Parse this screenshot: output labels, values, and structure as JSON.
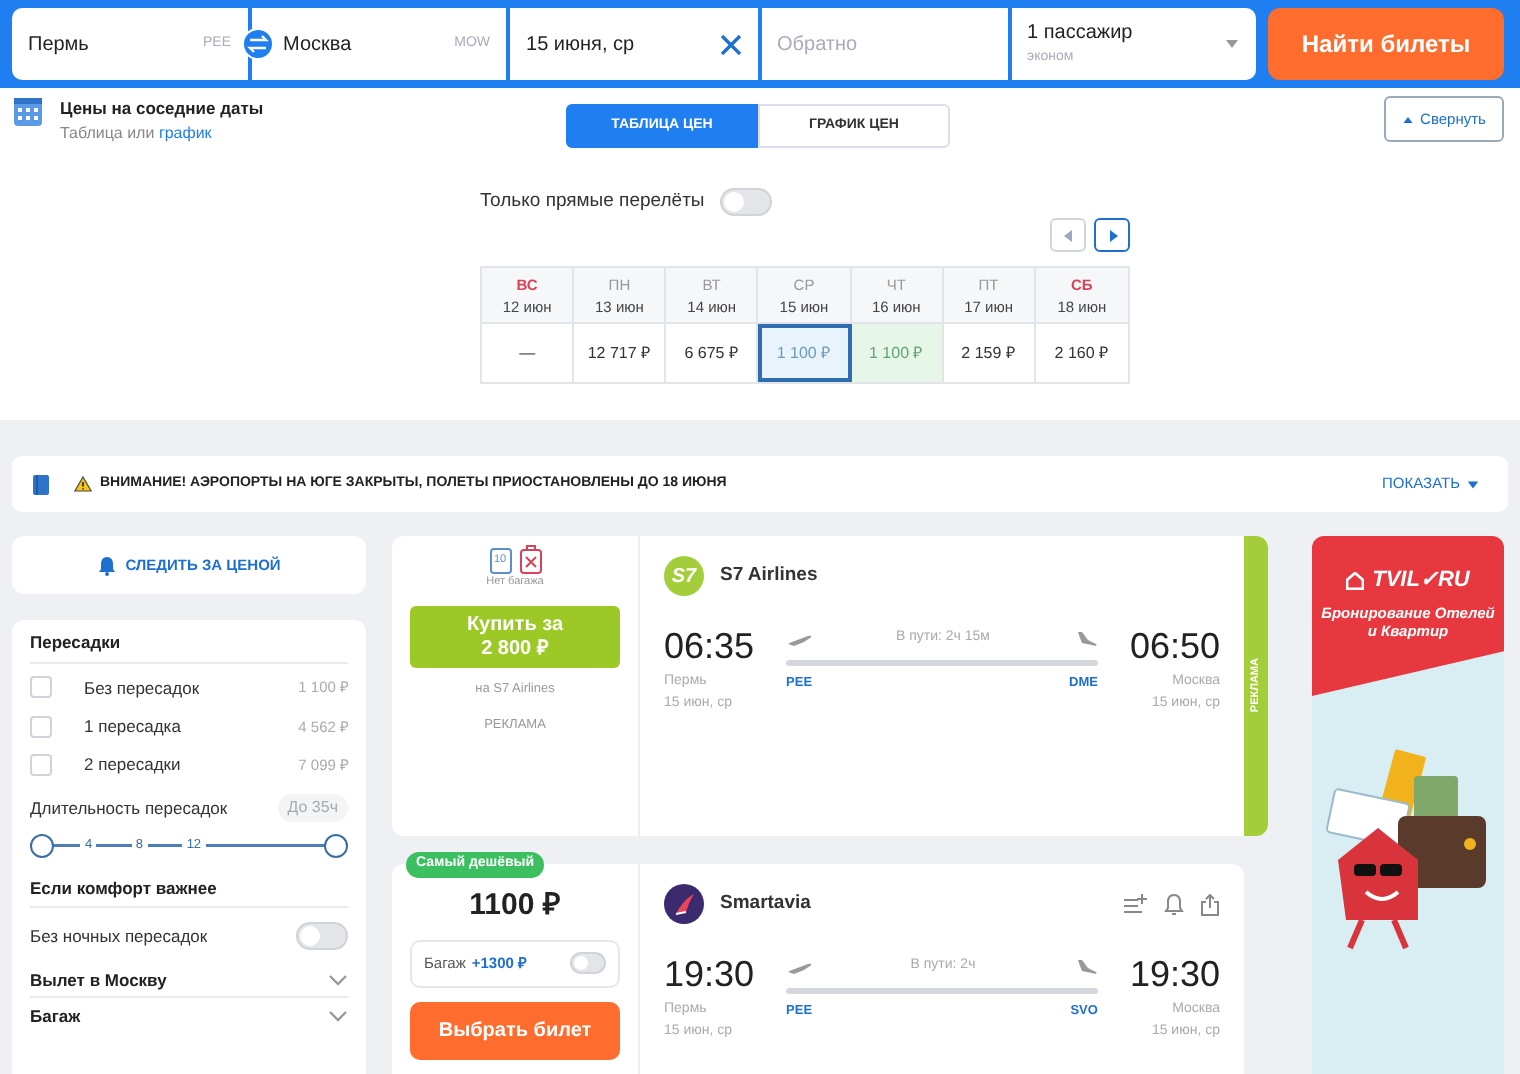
{
  "search_form": {
    "origin": {
      "city": "Пермь",
      "code": "PEE"
    },
    "destination": {
      "city": "Москва",
      "code": "MOW"
    },
    "depart_date": "15 июня, ср",
    "return_date": {
      "placeholder": "Обратно"
    },
    "passengers": {
      "count": "1 пассажир",
      "cabin": "эконом"
    },
    "search_button": "Найти билеты"
  },
  "nearby_dates": {
    "title": "Цены на соседние даты",
    "subtitle_text": "Таблица или",
    "subtitle_link": "график",
    "view_tabs": [
      {
        "label": "ТАБЛИЦА ЦЕН",
        "selected": true
      },
      {
        "label": "ГРАФИК ЦЕН",
        "selected": false
      }
    ],
    "collapse_button": "Свернуть",
    "direct_only": {
      "label": "Только прямые перелёты",
      "on": false
    },
    "days": [
      {
        "weekday": "ВС",
        "date": "12 июн",
        "price": "—",
        "weekend": true,
        "selected": false,
        "cheapest": false
      },
      {
        "weekday": "ПН",
        "date": "13 июн",
        "price": "12 717 ₽",
        "weekend": false,
        "selected": false,
        "cheapest": false
      },
      {
        "weekday": "ВТ",
        "date": "14 июн",
        "price": "6 675 ₽",
        "weekend": false,
        "selected": false,
        "cheapest": false
      },
      {
        "weekday": "СР",
        "date": "15 июн",
        "price": "1 100 ₽",
        "weekend": false,
        "selected": true,
        "cheapest": false
      },
      {
        "weekday": "ЧТ",
        "date": "16 июн",
        "price": "1 100 ₽",
        "weekend": false,
        "selected": false,
        "cheapest": true
      },
      {
        "weekday": "ПТ",
        "date": "17 июн",
        "price": "2 159 ₽",
        "weekend": false,
        "selected": false,
        "cheapest": false
      },
      {
        "weekday": "СБ",
        "date": "18 июн",
        "price": "2 160 ₽",
        "weekend": true,
        "selected": false,
        "cheapest": false
      }
    ]
  },
  "alert": {
    "text": "ВНИМАНИЕ! АЭРОПОРТЫ НА ЮГЕ ЗАКРЫТЫ, ПОЛЕТЫ ПРИОСТАНОВЛЕНЫ ДО 18 ИЮНЯ",
    "action": "ПОКАЗАТЬ"
  },
  "track_price_button": "СЛЕДИТЬ ЗА ЦЕНОЙ",
  "filters": {
    "stops_title": "Пересадки",
    "stops": [
      {
        "label": "Без пересадок",
        "price": "1 100 ₽",
        "checked": false
      },
      {
        "label": "1 пересадка",
        "price": "4 562 ₽",
        "checked": false
      },
      {
        "label": "2 пересадки",
        "price": "7 099 ₽",
        "checked": false
      }
    ],
    "duration": {
      "label": "Длительность пересадок",
      "value": "До 35ч",
      "ticks": [
        "4",
        "8",
        "12"
      ],
      "thumbs": [
        {
          "level": 0
        },
        {
          "level": 1
        }
      ]
    },
    "comfort_title": "Если комфорт важнее",
    "no_night": {
      "label": "Без ночных пересадок",
      "on": false
    },
    "sections": [
      {
        "label": "Вылет в Москву",
        "expanded": false
      },
      {
        "label": "Багаж",
        "expanded": false
      }
    ]
  },
  "tickets": [
    {
      "kind": "ad",
      "bag_size": "10",
      "baggage_note": "Нет багажа",
      "buy_label": "Купить за",
      "buy_price": "2 800 ₽",
      "seller": "на S7 Airlines",
      "ad_label": "РЕКЛАМА",
      "logo_text": "S7",
      "airline": "S7 Airlines",
      "depart": {
        "time": "06:35",
        "city": "Пермь",
        "date": "15 июн, ср",
        "code": "PEE"
      },
      "duration": "В пути: 2ч 15м",
      "arrive": {
        "time": "06:50",
        "city": "Москва",
        "date": "15 июн, ср",
        "code": "DME"
      },
      "side_label": "РЕКЛАМА"
    },
    {
      "kind": "regular",
      "badge": "Самый дешёвый",
      "price": "1100 ₽",
      "baggage": {
        "label": "Багаж",
        "price": "+1300 ₽",
        "on": false
      },
      "select_button": "Выбрать билет",
      "airline": "Smartavia",
      "depart": {
        "time": "19:30",
        "city": "Пермь",
        "date": "15 июн, ср",
        "code": "PEE"
      },
      "duration": "В пути: 2ч",
      "arrive": {
        "time": "19:30",
        "city": "Москва",
        "date": "15 июн, ср",
        "code": "SVO"
      }
    }
  ],
  "side_ad": {
    "brand": "TVIL✓RU",
    "tagline": "Бронирование Отелей и Квартир"
  }
}
